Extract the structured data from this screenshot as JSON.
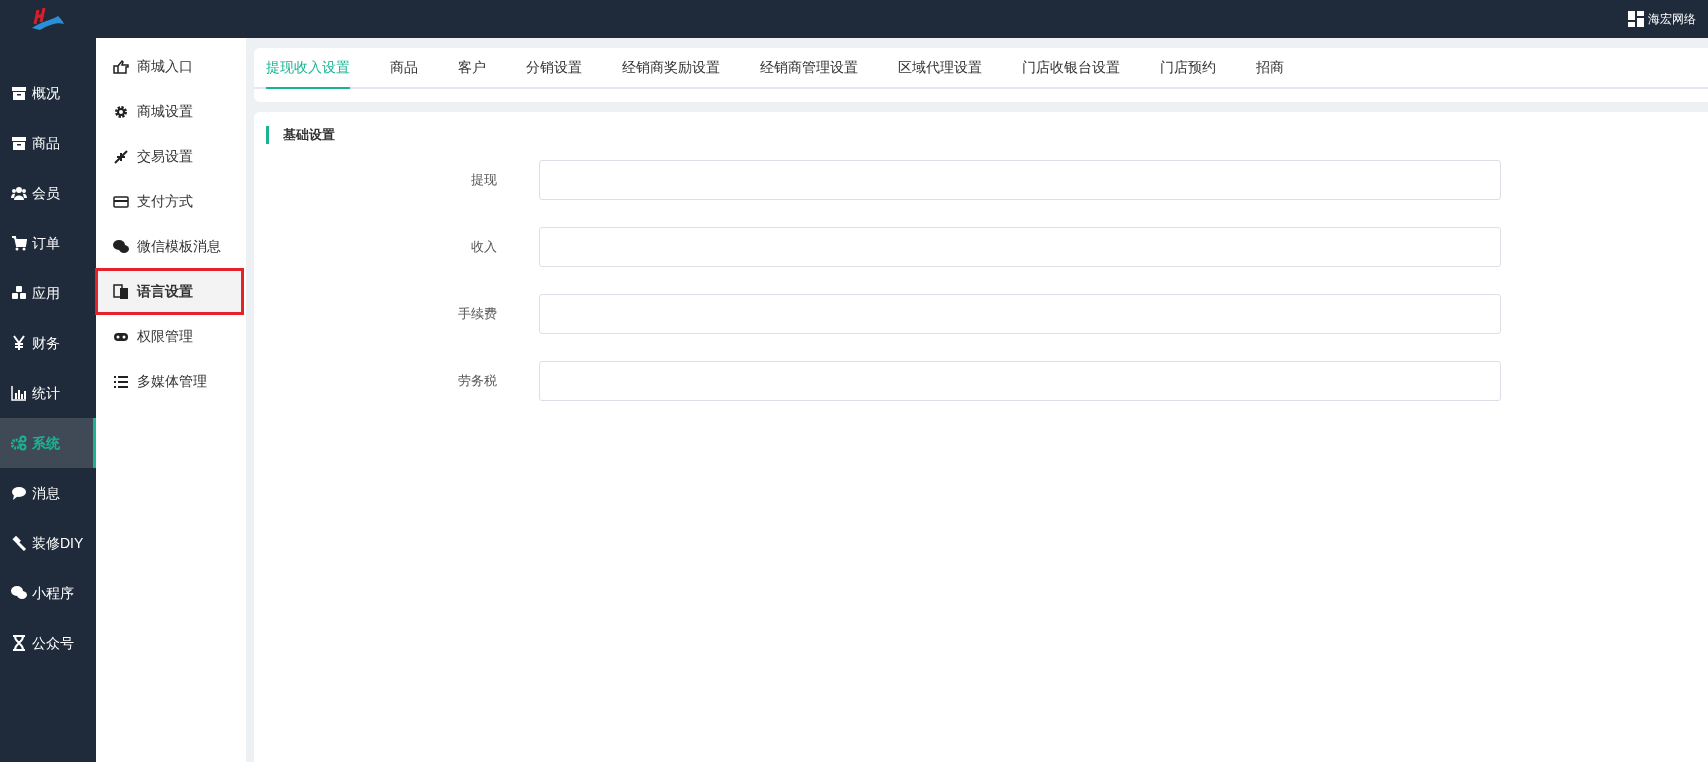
{
  "top_bar": {
    "user": "海宏网络"
  },
  "main_nav": [
    {
      "label": "概况",
      "selected": false
    },
    {
      "label": "商品",
      "selected": false
    },
    {
      "label": "会员",
      "selected": false
    },
    {
      "label": "订单",
      "selected": false
    },
    {
      "label": "应用",
      "selected": false
    },
    {
      "label": "财务",
      "selected": false
    },
    {
      "label": "统计",
      "selected": false
    },
    {
      "label": "系统",
      "selected": true
    },
    {
      "label": "消息",
      "selected": false
    },
    {
      "label": "装修DIY",
      "selected": false
    },
    {
      "label": "小程序",
      "selected": false
    },
    {
      "label": "公众号",
      "selected": false
    }
  ],
  "sub_nav": [
    {
      "label": "商城入口",
      "selected": false,
      "outlined": false
    },
    {
      "label": "商城设置",
      "selected": false,
      "outlined": false
    },
    {
      "label": "交易设置",
      "selected": false,
      "outlined": false
    },
    {
      "label": "支付方式",
      "selected": false,
      "outlined": false
    },
    {
      "label": "微信模板消息",
      "selected": false,
      "outlined": false
    },
    {
      "label": "语言设置",
      "selected": true,
      "outlined": true
    },
    {
      "label": "权限管理",
      "selected": false,
      "outlined": false
    },
    {
      "label": "多媒体管理",
      "selected": false,
      "outlined": false
    }
  ],
  "tabs": [
    {
      "label": "提现收入设置",
      "selected": true
    },
    {
      "label": "商品",
      "selected": false
    },
    {
      "label": "客户",
      "selected": false
    },
    {
      "label": "分销设置",
      "selected": false
    },
    {
      "label": "经销商奖励设置",
      "selected": false
    },
    {
      "label": "经销商管理设置",
      "selected": false
    },
    {
      "label": "区域代理设置",
      "selected": false
    },
    {
      "label": "门店收银台设置",
      "selected": false
    },
    {
      "label": "门店预约",
      "selected": false
    },
    {
      "label": "招商",
      "selected": false
    }
  ],
  "section": {
    "title": "基础设置",
    "fields": [
      {
        "label": "提现"
      },
      {
        "label": "收入"
      },
      {
        "label": "手续费"
      },
      {
        "label": "劳务税"
      }
    ]
  }
}
